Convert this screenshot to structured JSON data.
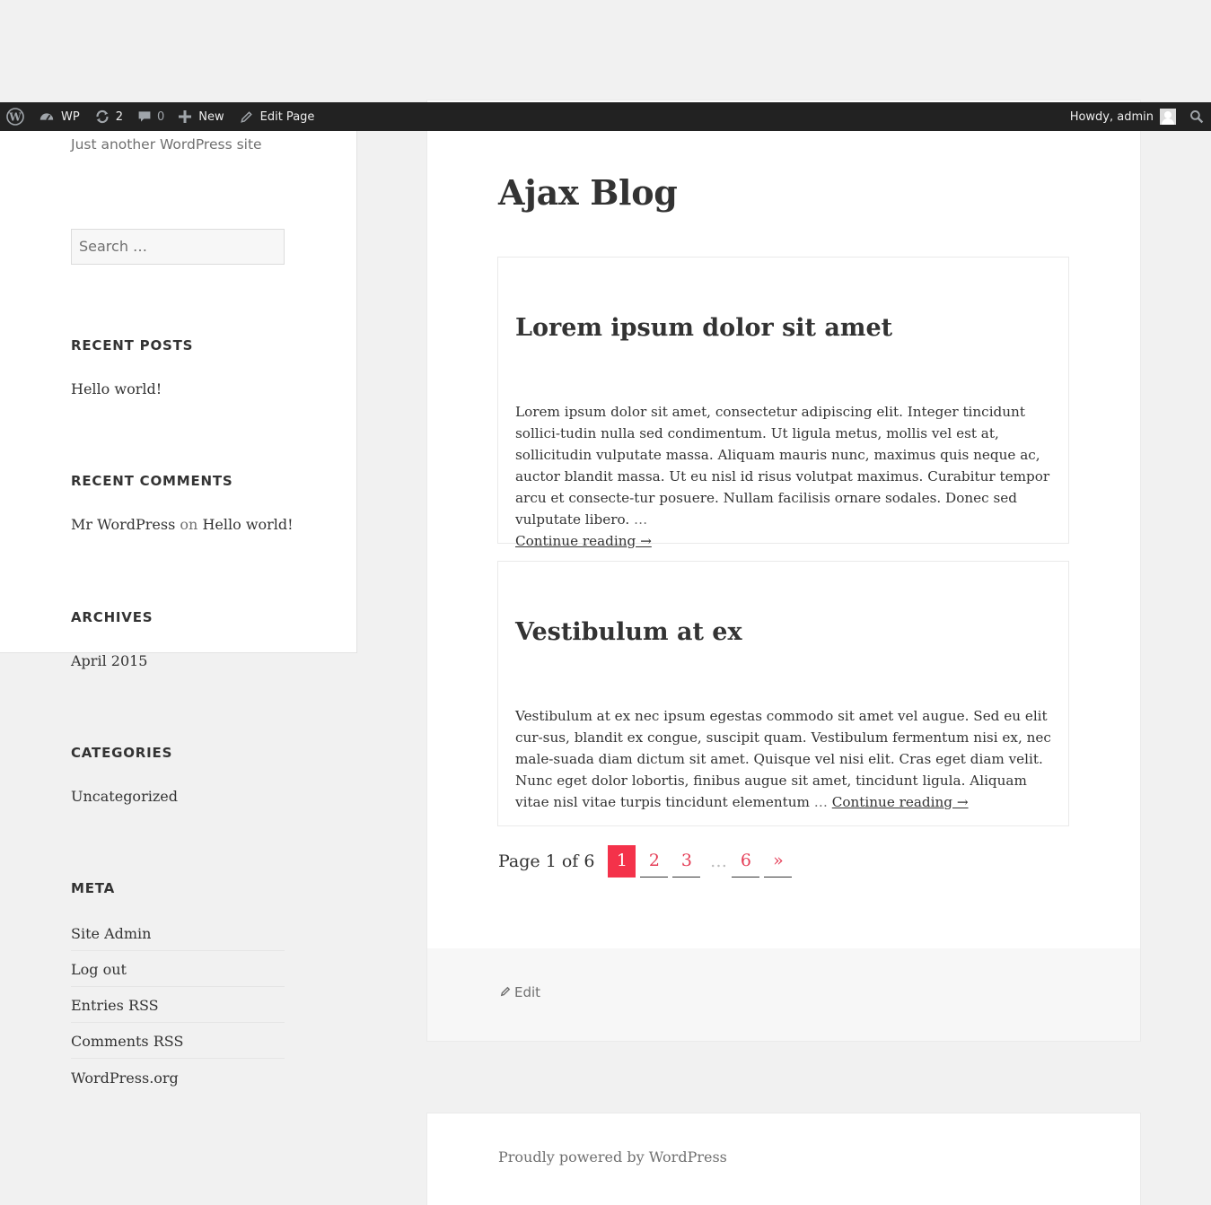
{
  "adminbar": {
    "site_name": "WP",
    "updates_count": "2",
    "comments_count": "0",
    "new_label": "New",
    "edit_label": "Edit Page",
    "howdy": "Howdy, admin"
  },
  "sidebar": {
    "tagline": "Just another WordPress site",
    "search_placeholder": "Search …",
    "recent_posts": {
      "title": "RECENT POSTS",
      "items": [
        "Hello world!"
      ]
    },
    "recent_comments": {
      "title": "RECENT COMMENTS",
      "author": "Mr WordPress",
      "on": "on",
      "post": "Hello world!"
    },
    "archives": {
      "title": "ARCHIVES",
      "items": [
        "April 2015"
      ]
    },
    "categories": {
      "title": "CATEGORIES",
      "items": [
        "Uncategorized"
      ]
    },
    "meta": {
      "title": "META",
      "items": [
        "Site Admin",
        "Log out",
        "Entries RSS",
        "Comments RSS",
        "WordPress.org"
      ]
    }
  },
  "main": {
    "title": "Ajax Blog",
    "posts": [
      {
        "title": "Lorem ipsum dolor sit amet",
        "excerpt": "Lorem ipsum dolor sit amet, consectetur adipiscing elit. Integer tincidunt sollici-tudin nulla sed condimentum. Ut ligula metus, mollis vel est at, sollicitudin vulputate massa. Aliquam mauris nunc, maximus quis neque ac, auctor blandit massa. Ut eu nisl id risus volutpat maximus. Curabitur tempor arcu et consecte-tur posuere. Nullam facilisis ornare sodales. Donec sed vulputate libero.",
        "ellipsis": "…",
        "more": "Continue reading →"
      },
      {
        "title": "Vestibulum at ex",
        "excerpt": "Vestibulum at ex nec ipsum egestas commodo sit amet vel augue. Sed eu elit cur-sus, blandit ex congue, suscipit quam. Vestibulum fermentum nisi ex, nec male-suada diam dictum sit amet. Quisque vel nisi elit. Cras eget diam velit. Nunc eget dolor lobortis, finibus augue sit amet, tincidunt ligula. Aliquam vitae nisl vitae turpis tincidunt elementum",
        "ellipsis": "…",
        "more": "Continue reading →"
      }
    ],
    "pagination": {
      "info": "Page 1 of 6",
      "pages": [
        "1",
        "2",
        "3"
      ],
      "dots": "…",
      "last": "6",
      "next": "»",
      "current": "1"
    },
    "edit": "Edit",
    "footer": "Proudly powered by WordPress"
  },
  "colors": {
    "accent": "#f4324a",
    "link": "#e53f58",
    "adminbar": "#222222"
  }
}
